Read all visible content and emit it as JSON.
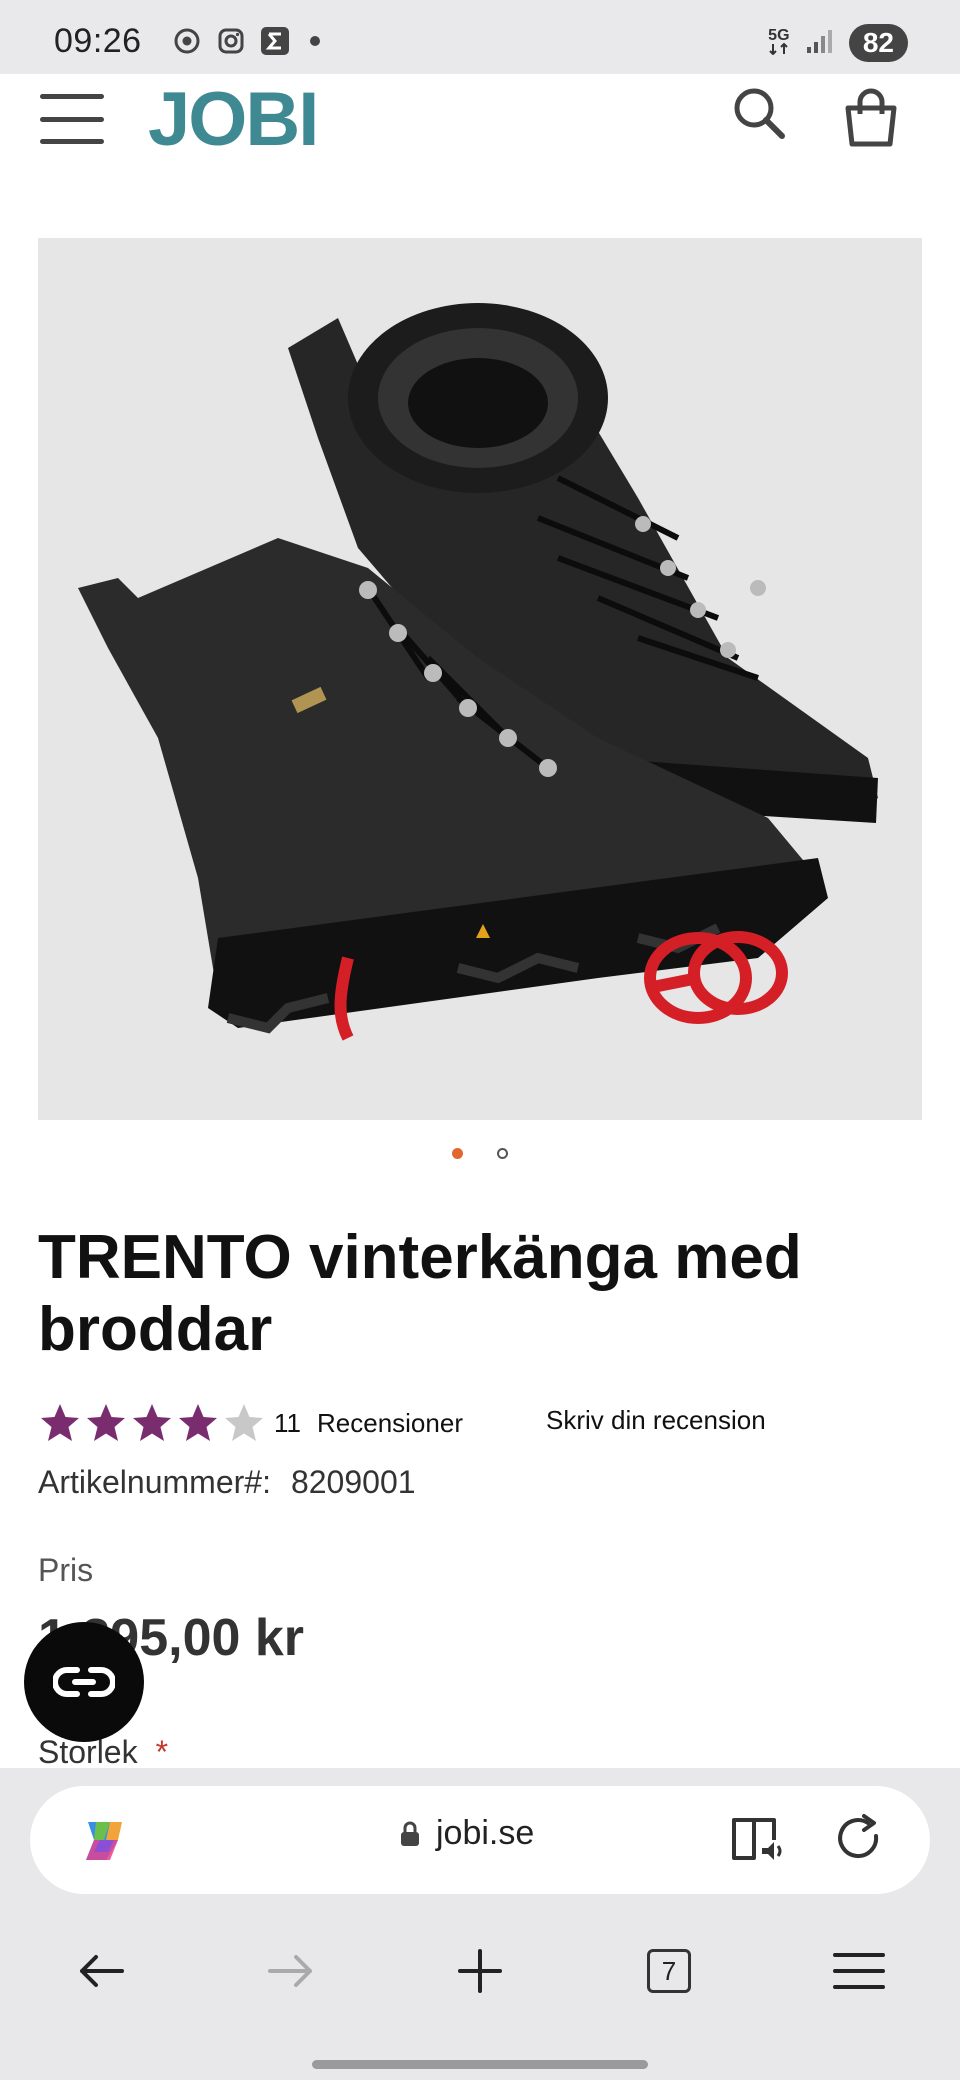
{
  "status_bar": {
    "time": "09:26",
    "network": "5G",
    "battery": "82"
  },
  "header": {
    "logo": "JOBI"
  },
  "product": {
    "title": "TRENTO vinterkänga med broddar",
    "rating": 4,
    "rating_max": 5,
    "review_count": "11",
    "reviews_label": "Recensioner",
    "write_review": "Skriv din recension",
    "sku_label": "Artikelnummer#:",
    "sku_value": "8209001",
    "price_label": "Pris",
    "price": "1.395,00 kr",
    "size_label": "Storlek",
    "required_mark": "*",
    "image_count": 2,
    "image_active": 1
  },
  "browser": {
    "url": "jobi.se",
    "tab_count": "7"
  },
  "colors": {
    "brand": "#3f8a92",
    "star": "#7a2d6e",
    "star_empty": "#c8c8c8",
    "dot_active": "#e2672e"
  },
  "icons": {
    "menu": "hamburger-icon",
    "search": "search-icon",
    "cart": "shopping-bag-icon",
    "copilot": "copilot-icon",
    "lock": "lock-icon",
    "reader": "reader-mode-icon",
    "reload": "reload-icon",
    "back": "back-arrow-icon",
    "forward": "forward-arrow-icon",
    "new_tab": "plus-icon",
    "tabs": "tabs-icon",
    "browser_menu": "menu-icon"
  }
}
